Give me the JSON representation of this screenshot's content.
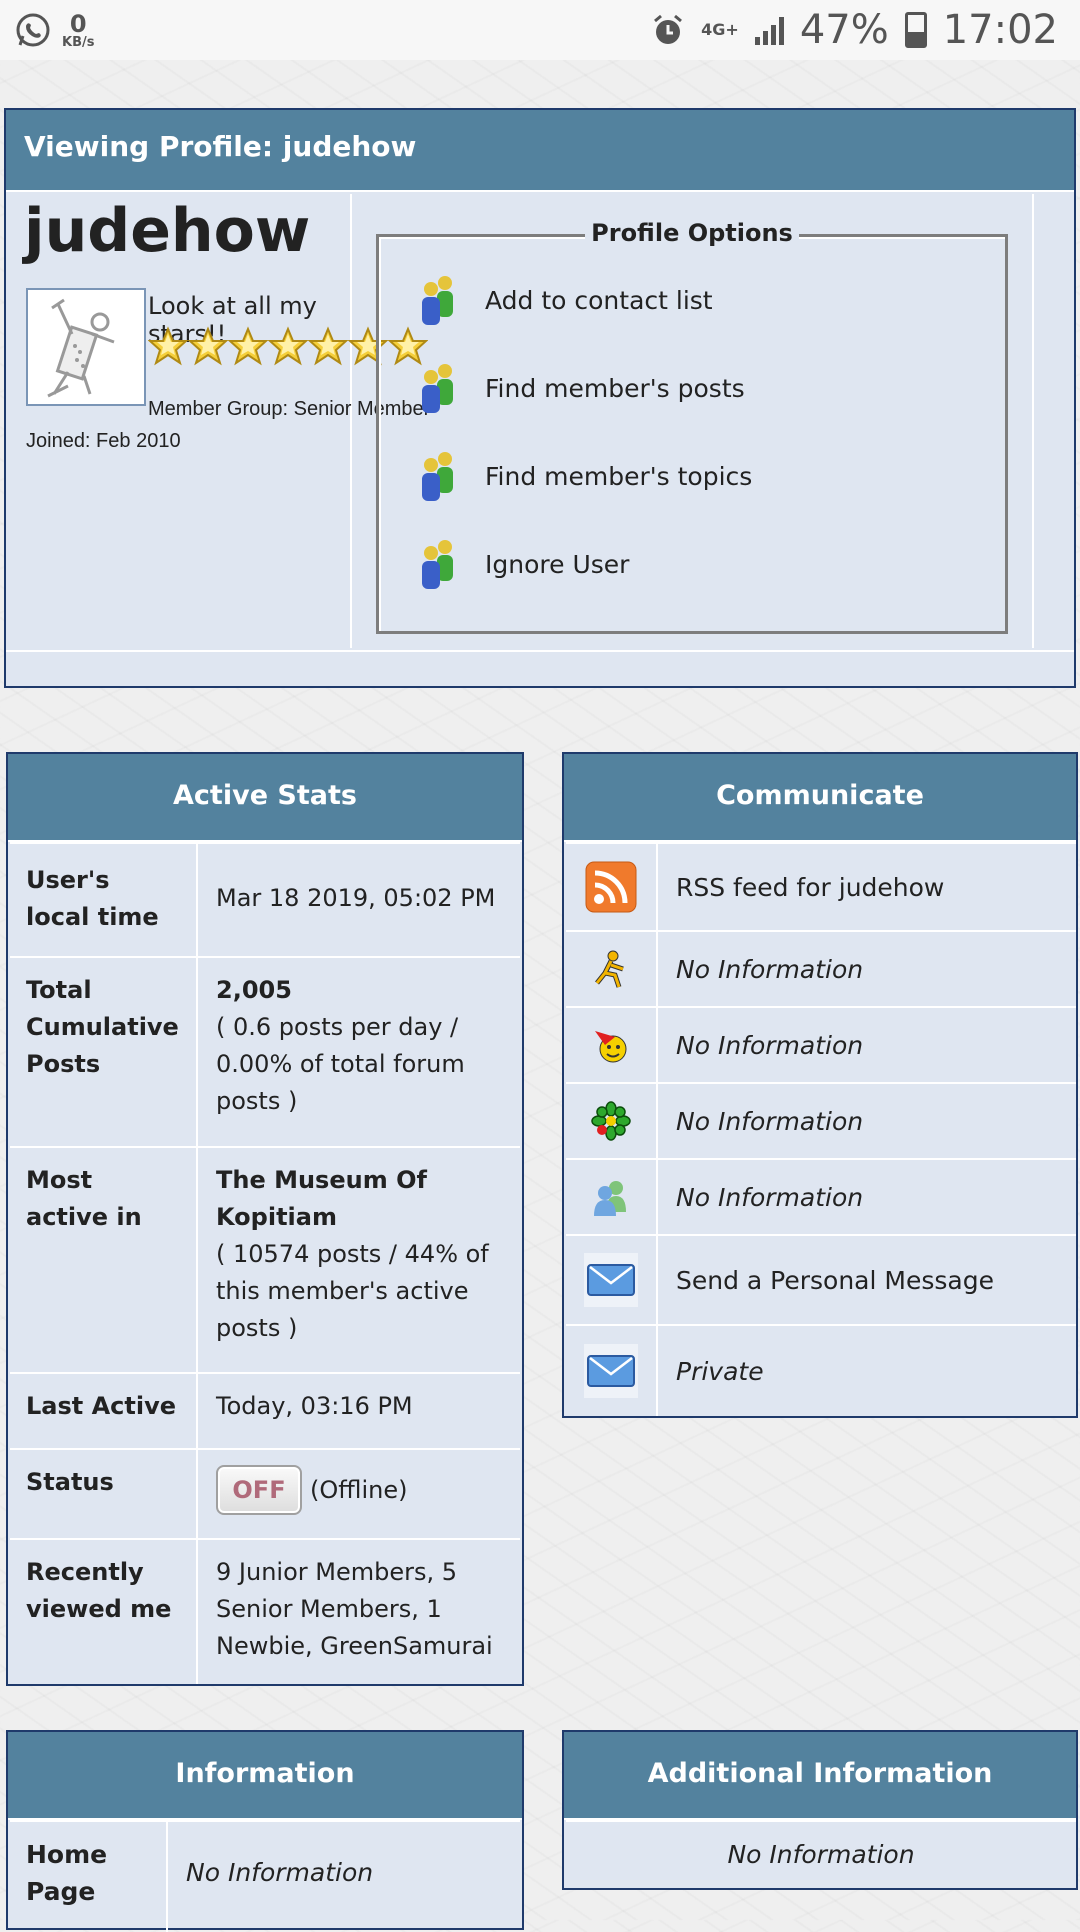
{
  "status_bar": {
    "kb_value": "0",
    "kb_unit": "KB/s",
    "network": "4G+",
    "battery": "47%",
    "time": "17:02"
  },
  "profile": {
    "header": "Viewing Profile: judehow",
    "username": "judehow",
    "stars_text": "Look at all my stars!!",
    "star_count": 7,
    "member_group": "Member Group: Senior Member",
    "joined": "Joined: Feb 2010",
    "options_title": "Profile Options",
    "options": [
      {
        "label": "Add to contact list",
        "icon": "users-icon"
      },
      {
        "label": "Find member's posts",
        "icon": "users-icon"
      },
      {
        "label": "Find member's topics",
        "icon": "users-icon"
      },
      {
        "label": "Ignore User",
        "icon": "users-icon"
      }
    ]
  },
  "active_stats": {
    "title": "Active Stats",
    "local_time_label": "User's local time",
    "local_time_value": "Mar 18 2019, 05:02 PM",
    "posts_label": "Total Cumulative Posts",
    "posts_count": "2,005",
    "posts_detail": "( 0.6 posts per day / 0.00% of total forum posts )",
    "most_active_label": "Most active in",
    "most_active_forum": "The Museum Of Kopitiam",
    "most_active_detail": "( 10574 posts / 44% of this member's active posts )",
    "last_active_label": "Last Active",
    "last_active_value": "Today, 03:16 PM",
    "status_label": "Status",
    "status_badge": "OFF",
    "status_value": "(Offline)",
    "recent_label": "Recently viewed me",
    "recent_value": "9 Junior Members, 5 Senior Members, 1 Newbie, GreenSamurai"
  },
  "communicate": {
    "title": "Communicate",
    "rows": [
      {
        "icon": "rss-icon",
        "text": "RSS feed for judehow",
        "italic": false
      },
      {
        "icon": "aim-icon",
        "text": "No Information",
        "italic": true
      },
      {
        "icon": "yahoo-icon",
        "text": "No Information",
        "italic": true
      },
      {
        "icon": "icq-icon",
        "text": "No Information",
        "italic": true
      },
      {
        "icon": "msn-icon",
        "text": "No Information",
        "italic": true
      },
      {
        "icon": "mail-icon",
        "text": "Send a Personal Message",
        "italic": false
      },
      {
        "icon": "mail-icon",
        "text": "Private",
        "italic": true
      }
    ]
  },
  "information": {
    "title": "Information",
    "home_page_label": "Home Page",
    "home_page_value": "No Information"
  },
  "additional_information": {
    "title": "Additional Information",
    "value": "No Information"
  },
  "colors": {
    "header_bg": "#53829e",
    "panel_bg": "#dfe6f1",
    "border": "#1f3a6b"
  }
}
